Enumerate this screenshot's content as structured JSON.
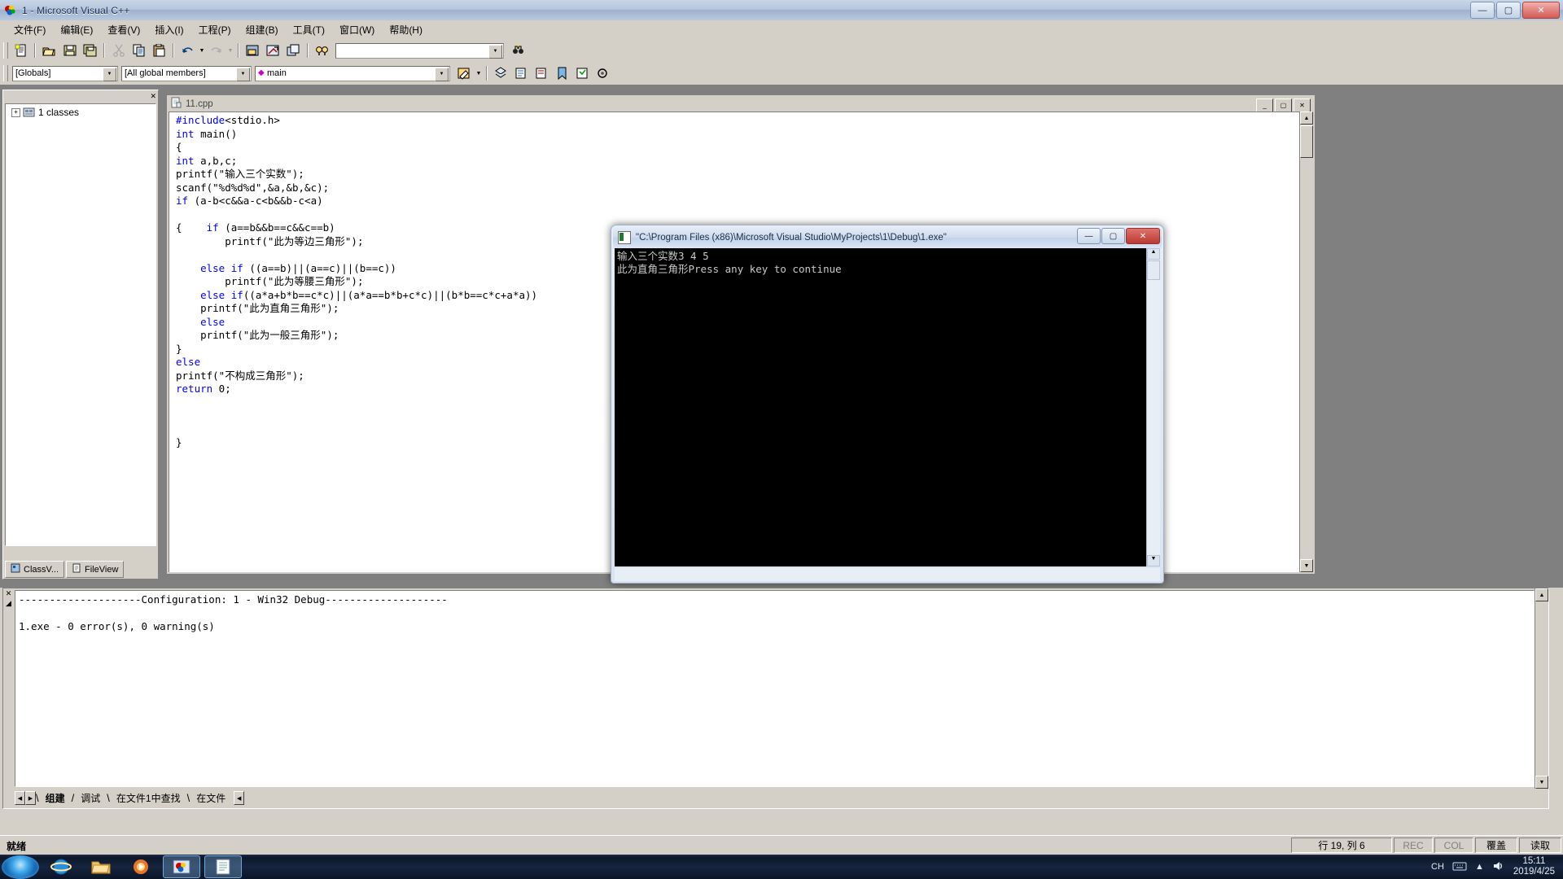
{
  "window": {
    "title": "1 - Microsoft Visual C++",
    "app_icon": "visualcpp-icon",
    "minimize": "—",
    "maximize": "▢",
    "close": "✕"
  },
  "menu": {
    "items": [
      {
        "label": "文件(F)",
        "name": "menu-file"
      },
      {
        "label": "编辑(E)",
        "name": "menu-edit"
      },
      {
        "label": "查看(V)",
        "name": "menu-view"
      },
      {
        "label": "插入(I)",
        "name": "menu-insert"
      },
      {
        "label": "工程(P)",
        "name": "menu-project"
      },
      {
        "label": "组建(B)",
        "name": "menu-build"
      },
      {
        "label": "工具(T)",
        "name": "menu-tools"
      },
      {
        "label": "窗口(W)",
        "name": "menu-window"
      },
      {
        "label": "帮助(H)",
        "name": "menu-help"
      }
    ]
  },
  "toolbar_standard": {
    "buttons": [
      {
        "name": "new-text-file-icon",
        "tip": "New Text File"
      },
      {
        "name": "open-icon",
        "tip": "Open"
      },
      {
        "name": "save-icon",
        "tip": "Save"
      },
      {
        "name": "save-all-icon",
        "tip": "Save All"
      },
      {
        "name": "cut-icon",
        "tip": "Cut"
      },
      {
        "name": "copy-icon",
        "tip": "Copy"
      },
      {
        "name": "paste-icon",
        "tip": "Paste"
      },
      {
        "name": "undo-icon",
        "tip": "Undo"
      },
      {
        "name": "redo-icon",
        "tip": "Redo"
      },
      {
        "name": "workspace-icon",
        "tip": "Workspace"
      },
      {
        "name": "output-icon",
        "tip": "Output"
      },
      {
        "name": "window-list-icon",
        "tip": "Windows"
      },
      {
        "name": "find-in-files-icon",
        "tip": "Find in Files"
      }
    ],
    "search_value": "",
    "search_placeholder": "",
    "find_icon": "binoculars-icon"
  },
  "toolbar_wizard": {
    "scope_combo": "[Globals]",
    "members_combo": "[All global members]",
    "symbol_combo": "main",
    "symbol_glyph": "◆",
    "buttons": [
      {
        "name": "wizardbar-action-icon"
      },
      {
        "name": "class-wizard-icon"
      },
      {
        "name": "goto-definition-icon"
      },
      {
        "name": "goto-declaration-icon"
      },
      {
        "name": "bookmark-icon"
      },
      {
        "name": "edit-code-icon"
      },
      {
        "name": "properties-icon"
      }
    ]
  },
  "workspace_pane": {
    "close_icon": "✕",
    "tree_root": "1 classes",
    "tree_expander": "+",
    "tree_icon": "classes-folder-icon",
    "tabs": [
      {
        "label": "ClassV...",
        "name": "tab-classview",
        "icon": "classview-icon",
        "active": true
      },
      {
        "label": "FileView",
        "name": "tab-fileview",
        "icon": "fileview-icon",
        "active": false
      }
    ]
  },
  "editor": {
    "tab_title": "11.cpp",
    "doc_icon": "cpp-file-icon",
    "minimize": "_",
    "maximize": "▢",
    "close": "✕",
    "code_lines": [
      {
        "text": "#include<stdio.h>",
        "cls": "pp"
      },
      {
        "text": "int main()",
        "cls": "kw1"
      },
      {
        "text": "{",
        "cls": "plain"
      },
      {
        "text": "int a,b,c;",
        "cls": "kw1"
      },
      {
        "text": "printf(\"输入三个实数\");",
        "cls": "plain"
      },
      {
        "text": "scanf(\"%d%d%d\",&a,&b,&c);",
        "cls": "plain"
      },
      {
        "text": "if (a-b<c&&a-c<b&&b-c<a)",
        "cls": "kwif"
      },
      {
        "text": "",
        "cls": "plain"
      },
      {
        "text": "{    if (a==b&&b==c&&c==b)",
        "cls": "brace-if"
      },
      {
        "text": "        printf(\"此为等边三角形\");",
        "cls": "plain"
      },
      {
        "text": "",
        "cls": "plain"
      },
      {
        "text": "    else if ((a==b)||(a==c)||(b==c))",
        "cls": "elseif"
      },
      {
        "text": "        printf(\"此为等腰三角形\");",
        "cls": "plain"
      },
      {
        "text": "    else if((a*a+b*b==c*c)||(a*a==b*b+c*c)||(b*b==c*c+a*a))",
        "cls": "elseif"
      },
      {
        "text": "    printf(\"此为直角三角形\");",
        "cls": "plain"
      },
      {
        "text": "    else",
        "cls": "kwelse"
      },
      {
        "text": "    printf(\"此为一般三角形\");",
        "cls": "plain"
      },
      {
        "text": "}",
        "cls": "plain"
      },
      {
        "text": "else",
        "cls": "kwelse"
      },
      {
        "text": "printf(\"不构成三角形\");",
        "cls": "plain"
      },
      {
        "text": "return 0;",
        "cls": "kwreturn"
      },
      {
        "text": "",
        "cls": "plain"
      },
      {
        "text": "",
        "cls": "plain"
      },
      {
        "text": "",
        "cls": "plain"
      },
      {
        "text": "}",
        "cls": "plain"
      }
    ]
  },
  "console_window": {
    "title": "\"C:\\Program Files (x86)\\Microsoft Visual Studio\\MyProjects\\1\\Debug\\1.exe\"",
    "icon": "console-icon",
    "minimize": "—",
    "maximize": "▢",
    "close": "✕",
    "output_lines": [
      "输入三个实数3 4 5",
      "此为直角三角形Press any key to continue"
    ]
  },
  "output_pane": {
    "close_icon": "✕",
    "collapse_icon": "◢",
    "lines": [
      "--------------------Configuration: 1 - Win32 Debug--------------------",
      "",
      "1.exe - 0 error(s), 0 warning(s)"
    ],
    "nav_prev": "◀",
    "nav_next": "▶",
    "tabs": [
      {
        "label": "组建",
        "name": "output-tab-build",
        "active": true
      },
      {
        "label": "调试",
        "name": "output-tab-debug",
        "active": false
      },
      {
        "label": "在文件1中查找",
        "name": "output-tab-find-in-files-1",
        "active": false
      },
      {
        "label": "在文件",
        "name": "output-tab-find-in-files-2",
        "active": false
      }
    ],
    "scroll_left": "◀"
  },
  "status_bar": {
    "message": "就绪",
    "position": "行 19, 列 6",
    "indicators": [
      {
        "label": "REC",
        "dim": true
      },
      {
        "label": "COL",
        "dim": true
      },
      {
        "label": "覆盖",
        "dim": false
      },
      {
        "label": "读取",
        "dim": false
      }
    ]
  },
  "taskbar": {
    "start": "start-orb",
    "items": [
      {
        "name": "taskbar-ie-icon",
        "active": false
      },
      {
        "name": "taskbar-explorer-icon",
        "active": false
      },
      {
        "name": "taskbar-media-icon",
        "active": false
      },
      {
        "name": "taskbar-vcpp-icon",
        "active": true
      },
      {
        "name": "taskbar-doc-icon",
        "active": true
      }
    ],
    "tray": {
      "ime": "CH",
      "keyboard_icon": "keyboard-icon",
      "show_hidden_icon": "▲",
      "volume_icon": "speaker-icon",
      "time": "15:11",
      "date": "2019/4/25"
    }
  },
  "colors": {
    "keyword_blue": "#0000ff",
    "chrome": "#d4d0c8",
    "desktop": "#3a6ea5",
    "console_bg": "#000000",
    "console_fg": "#c8c8c8"
  }
}
